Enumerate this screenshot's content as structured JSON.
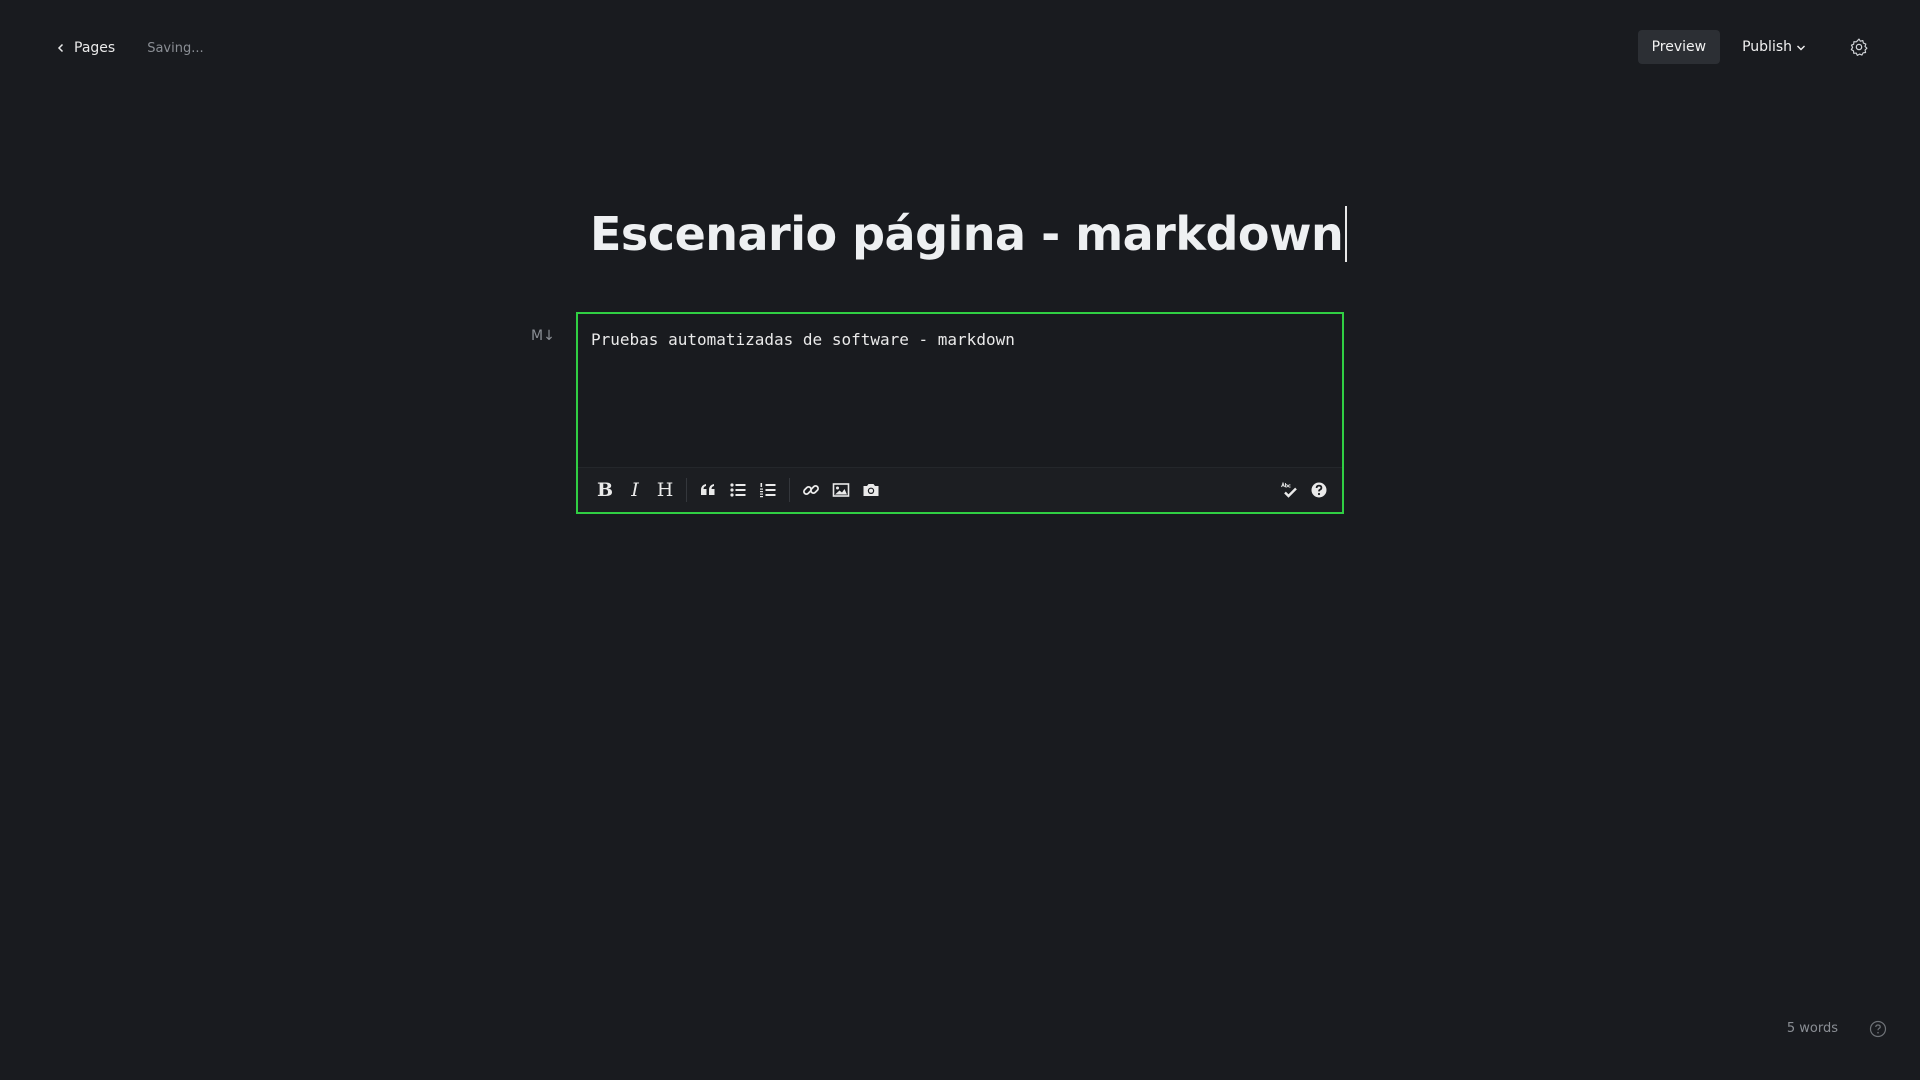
{
  "header": {
    "back_label": "Pages",
    "status": "Saving...",
    "preview_label": "Preview",
    "publish_label": "Publish"
  },
  "editor": {
    "title": "Escenario página - markdown",
    "markdown_badge": "M↓",
    "markdown_content": "Pruebas automatizadas de software - markdown",
    "toolbar": {
      "bold": "B",
      "italic": "I",
      "heading": "H"
    },
    "border_color": "#30cf43"
  },
  "footer": {
    "word_count": "5 words"
  },
  "icons": [
    "chevron-left-icon",
    "chevron-down-icon",
    "gear-icon",
    "quote-icon",
    "unordered-list-icon",
    "ordered-list-icon",
    "link-icon",
    "image-icon",
    "camera-icon",
    "spellcheck-icon",
    "help-icon"
  ]
}
